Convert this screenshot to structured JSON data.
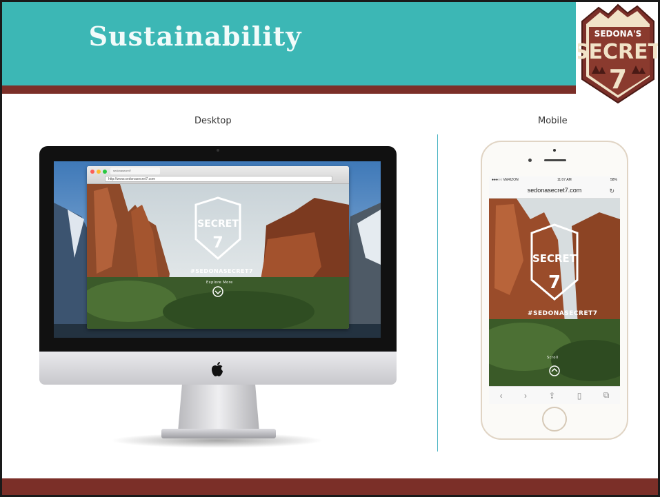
{
  "slide": {
    "title": "Sustainability",
    "desktop_label": "Desktop",
    "mobile_label": "Mobile"
  },
  "logo": {
    "line1": "SEDONA'S",
    "line2": "SECRET",
    "line3": "7"
  },
  "desktop_browser": {
    "tab_title": "sedonasecret7",
    "url": "http://www.sedonasecret7.com",
    "hashtag": "#SEDONASECRET7",
    "scroll_hint": "Explore More"
  },
  "mobile": {
    "status_carrier": "●●●○○ VERIZON",
    "status_time": "11:07 AM",
    "status_battery": "58%",
    "url": "sedonasecret7.com",
    "hashtag": "#SEDONASECRET7",
    "scroll_hint": "Scroll"
  },
  "colors": {
    "teal": "#3cb7b5",
    "maroon": "#7b2f28",
    "divider": "#4bb5c3"
  },
  "icons": {
    "reload": "reload-icon",
    "apple": "apple-icon",
    "share": "share-icon",
    "bookmarks": "bookmarks-icon",
    "tabs": "tabs-icon"
  }
}
